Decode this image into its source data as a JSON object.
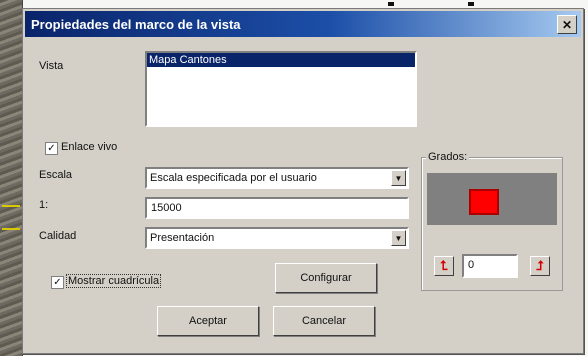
{
  "dialog": {
    "title": "Propiedades del marco de la vista",
    "close_icon": "close-icon"
  },
  "form": {
    "vista_label": "Vista",
    "vista_items": [
      "Mapa Cantones"
    ],
    "enlace_label": "Enlace vivo",
    "enlace_checked": true,
    "escala_label": "Escala",
    "escala_value": "Escala especificada por el usuario",
    "ratio_label": "1:",
    "ratio_value": "15000",
    "calidad_label": "Calidad",
    "calidad_value": "Presentación",
    "cuadricula_label": "Mostrar cuadrícula",
    "cuadricula_checked": true,
    "configurar_label": "Configurar",
    "aceptar_label": "Aceptar",
    "cancelar_label": "Cancelar"
  },
  "grados": {
    "title": "Grados:",
    "value": "0",
    "preview_color": "#ff0000",
    "rotate_left_icon": "rotate-left-icon",
    "rotate_right_icon": "rotate-right-icon"
  },
  "colors": {
    "titlebar_start": "#0a246a",
    "titlebar_end": "#a6caf0",
    "selection": "#0a246a",
    "face": "#d4d0c8"
  }
}
